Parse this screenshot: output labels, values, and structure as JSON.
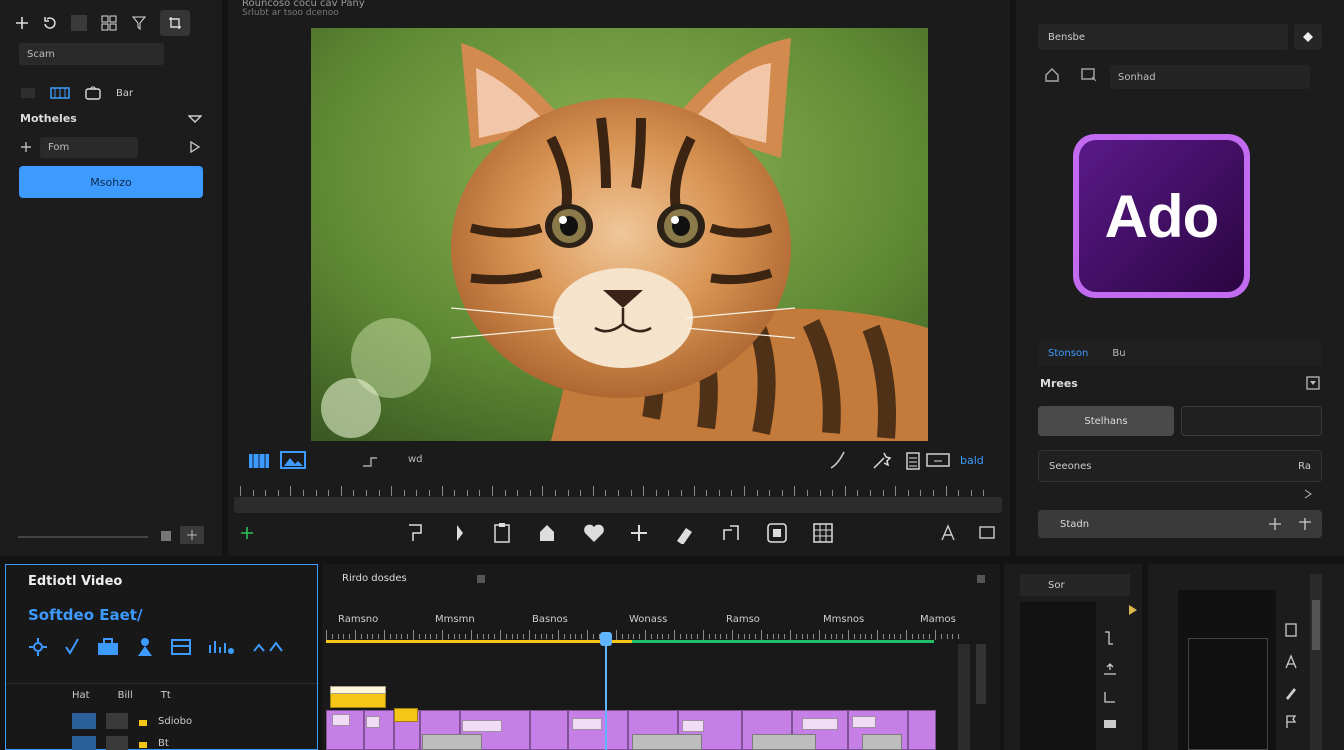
{
  "left_panel": {
    "search_value": "Scam",
    "view_label": "Bar",
    "section_title": "Motheles",
    "input_value": "Fom",
    "primary_button": "Msohzo"
  },
  "header": {
    "title": "Rouncoso cocu cav Pany",
    "subtitle": "Srlubt ar tsoo dcenoo"
  },
  "preview": {
    "image_alt": "Bengal kitten close-up",
    "toolbar_right_label": "bald",
    "toolbar_mid_label": "wd"
  },
  "right_panel": {
    "top_dropdown": "Bensbe",
    "search_placeholder": "Sonhad",
    "app_logo_text": "Ado",
    "tab_active": "Stonson",
    "tab_other": "Bu",
    "section_title": "Mrees",
    "button_left": "Stelhans",
    "row_label": "Seeones",
    "row_value": "Ra",
    "footer_button": "Stadn"
  },
  "left_bottom": {
    "title": "Edtiotl Video",
    "subtitle": "Softdeo Eaet/",
    "col1": "Hat",
    "col2": "Bill",
    "col3": "Tt",
    "row1_label": "Sdiobo",
    "row2_label": "Bt"
  },
  "timeline": {
    "title": "Rirdo dosdes",
    "markers": [
      "Ramsno",
      "Mmsmn",
      "Basnos",
      "Wonass",
      "Ramso",
      "Mmsnos",
      "Mamos"
    ]
  },
  "bottom_right": {
    "label": "Sor"
  },
  "colors": {
    "accent": "#3d9bff",
    "clip_purple": "#c77fe8",
    "clip_yellow": "#f5c518",
    "playhead": "#5fb6ff",
    "timeline_green": "#1fbf6a",
    "logo_purple": "#b34cf5"
  }
}
